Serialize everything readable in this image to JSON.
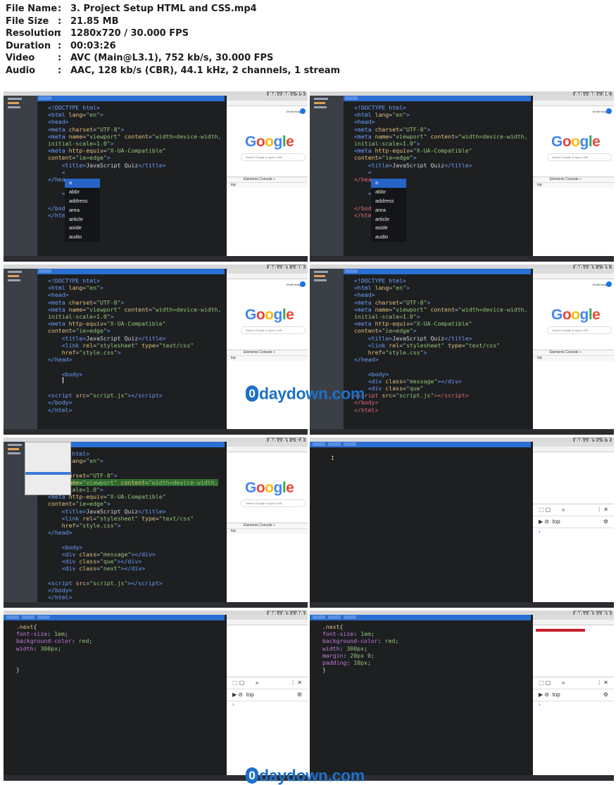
{
  "file_info": [
    {
      "key": "File Name",
      "value": "3. Project Setup HTML and CSS.mp4"
    },
    {
      "key": "File Size",
      "value": "21.85 MB"
    },
    {
      "key": "Resolution",
      "value": "1280x720 / 30.000 FPS"
    },
    {
      "key": "Duration",
      "value": "00:03:26"
    },
    {
      "key": "Video",
      "value": "AVC (Main@L3.1), 752 kb/s, 30.000 FPS"
    },
    {
      "key": "Audio",
      "value": "AAC, 128 kb/s (CBR), 44.1 kHz, 2 channels, 1 stream"
    }
  ],
  "separator": ":",
  "thumbnails": [
    {
      "timestamp": "00:00:22"
    },
    {
      "timestamp": "00:00:45"
    },
    {
      "timestamp": "00:01:08"
    },
    {
      "timestamp": "00:01:31"
    },
    {
      "timestamp": "00:01:54"
    },
    {
      "timestamp": "00:02:17"
    },
    {
      "timestamp": "00:02:40"
    },
    {
      "timestamp": "00:03:03"
    }
  ],
  "autocomplete": [
    "a",
    "abbr",
    "address",
    "area",
    "article",
    "aside",
    "audio"
  ],
  "google": {
    "logo": "Google",
    "search_placeholder": "Search Google or type a URL",
    "links": "Gmail  Images"
  },
  "devtools": {
    "tabs": "Elements  Console  »",
    "context": "top",
    "filter": "Filter"
  },
  "watermark": {
    "o": "0",
    "text": "daydown.com"
  },
  "accent_colors": {
    "editor_bg": "#1d1f21",
    "tabbar": "#2a6fd1",
    "watermark": "#1e70c8",
    "red_div": "#c81e2a"
  }
}
